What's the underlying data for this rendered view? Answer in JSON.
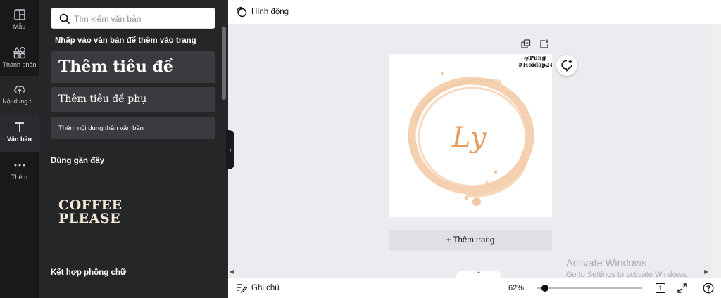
{
  "rail": {
    "items": [
      {
        "label": "Mẫu",
        "icon": "template-icon"
      },
      {
        "label": "Thành phần",
        "icon": "elements-icon"
      },
      {
        "label": "Nội dung t...",
        "icon": "upload-icon"
      },
      {
        "label": "Văn bản",
        "icon": "text-icon"
      },
      {
        "label": "Thêm",
        "icon": "more-icon"
      }
    ]
  },
  "panel": {
    "search_placeholder": "Tìm kiếm văn bản",
    "hint": "Nhấp vào văn bản để thêm vào trang",
    "heading": "Thêm tiêu đề",
    "subheading": "Thêm tiêu đề phụ",
    "body": "Thêm nội dung thân văn bản",
    "recent_label": "Dùng gần đây",
    "recent_item_line1": "COFFEE",
    "recent_item_line2": "PLEASE",
    "combos_label": "Kết hợp phông chữ"
  },
  "topbar": {
    "animate_label": "Hình động"
  },
  "canvas": {
    "watermark_line1": "@Pung",
    "watermark_line2": "#Hoidap247",
    "logo_text": "Ly",
    "add_page_label": "+ Thêm trang"
  },
  "windows_watermark": {
    "line1": "Activate Windows",
    "line2": "Go to Settings to activate Windows."
  },
  "bottombar": {
    "notes_label": "Ghi chú",
    "zoom": "62%",
    "zoom_fraction": 0.08,
    "page_count": "1"
  },
  "colors": {
    "rail_bg": "#18191b",
    "panel_bg": "#252627",
    "button_bg": "#3a3b3e",
    "canvas_bg": "#ebecf0",
    "ring": "#f3c9a5",
    "logo": "#e79c5d"
  }
}
